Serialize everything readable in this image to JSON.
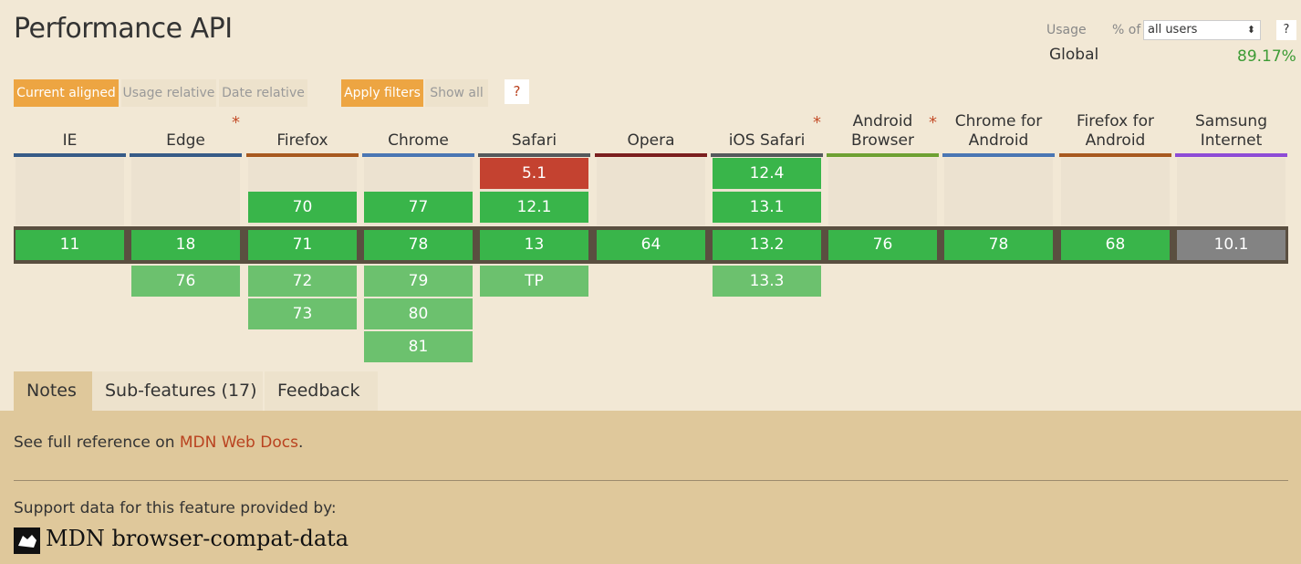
{
  "title": "Performance API",
  "usage": {
    "label": "Usage",
    "pct_of": "% of",
    "select_value": "all users",
    "help": "?",
    "global_label": "Global",
    "global_value": "89.17%"
  },
  "filters": {
    "current_aligned": "Current aligned",
    "usage_relative": "Usage relative",
    "date_relative": "Date relative",
    "apply_filters": "Apply filters",
    "show_all": "Show all",
    "help": "?"
  },
  "browsers": [
    {
      "name": "IE",
      "color": "#375b87",
      "star": "",
      "past": [],
      "current": "11",
      "future": []
    },
    {
      "name": "Edge",
      "color": "#375b87",
      "star": "*",
      "past": [],
      "current": "18",
      "future": [
        "76"
      ]
    },
    {
      "name": "Firefox",
      "color": "#a8591f",
      "star": "",
      "past": [
        "70"
      ],
      "current": "71",
      "future": [
        "72",
        "73"
      ]
    },
    {
      "name": "Chrome",
      "color": "#4a76b3",
      "star": "",
      "past": [
        "77"
      ],
      "current": "78",
      "future": [
        "79",
        "80",
        "81"
      ]
    },
    {
      "name": "Safari",
      "color": "#55595c",
      "star": "",
      "past": [
        "5.1",
        "12.1"
      ],
      "current": "13",
      "future": [
        "TP"
      ]
    },
    {
      "name": "Opera",
      "color": "#7b1e1e",
      "star": "",
      "past": [],
      "current": "64",
      "future": []
    },
    {
      "name": "iOS Safari",
      "color": "#55595c",
      "star": "*",
      "past": [
        "12.4",
        "13.1"
      ],
      "current": "13.2",
      "future": [
        "13.3"
      ]
    },
    {
      "name": "Android Browser",
      "color": "#6ea132",
      "star": "*",
      "past": [],
      "current": "76",
      "future": []
    },
    {
      "name": "Chrome for Android",
      "color": "#4a76b3",
      "star": "",
      "past": [],
      "current": "78",
      "future": []
    },
    {
      "name": "Firefox for Android",
      "color": "#a8591f",
      "star": "",
      "past": [],
      "current": "68",
      "future": []
    },
    {
      "name": "Samsung Internet",
      "color": "#8e4bd6",
      "star": "",
      "past": [],
      "current": "10.1",
      "future": []
    }
  ],
  "tabs": {
    "notes": "Notes",
    "subfeatures": "Sub-features (17)",
    "feedback": "Feedback"
  },
  "notes": {
    "prefix": "See full reference on ",
    "link": "MDN Web Docs",
    "suffix": ".",
    "support": "Support data for this feature provided by:",
    "mdn_logo_text": "MDN browser-compat-data"
  }
}
